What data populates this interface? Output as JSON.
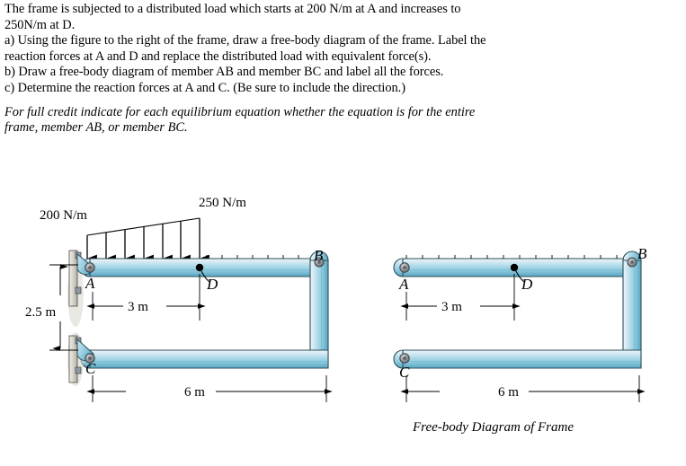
{
  "problem": {
    "lines": [
      "The frame is subjected to a distributed load which starts at 200 N/m at A and increases to",
      "250N/m at D.",
      "a) Using the figure to the right of the frame, draw a free-body diagram of the frame. Label the",
      "reaction forces at A and D and replace the distributed load with equivalent force(s).",
      "b) Draw a free-body diagram of member AB and member BC and label all the forces.",
      "c) Determine the reaction forces at A and C. (Be sure to include the direction.)"
    ],
    "note_lines": [
      "For full credit indicate for each equilibrium equation whether the equation is for the entire",
      "frame, member AB, or member BC."
    ]
  },
  "left_figure": {
    "name": "frame-with-loads",
    "load_start_label": "200 N/m",
    "load_end_label": "250 N/m",
    "point_a": "A",
    "point_b": "B",
    "point_c": "C",
    "point_d": "D",
    "dim_height": "2.5 m",
    "dim_ad": "3 m",
    "dim_span": "6 m",
    "arrow_count": 7
  },
  "right_figure": {
    "name": "free-body-diagram-frame",
    "point_a": "A",
    "point_b": "B",
    "point_c": "C",
    "point_d": "D",
    "dim_ad": "3 m",
    "dim_span": "6 m",
    "caption": "Free-body Diagram of Frame"
  },
  "colors": {
    "beam_light": "#d6eaf2",
    "beam_mid": "#a9d6e5",
    "beam_dark": "#5ba9c4",
    "beam_edge": "#2f4f5a",
    "support_plate": "#c9c6bd",
    "pin_fill": "#8d9196",
    "line": "#000000"
  }
}
